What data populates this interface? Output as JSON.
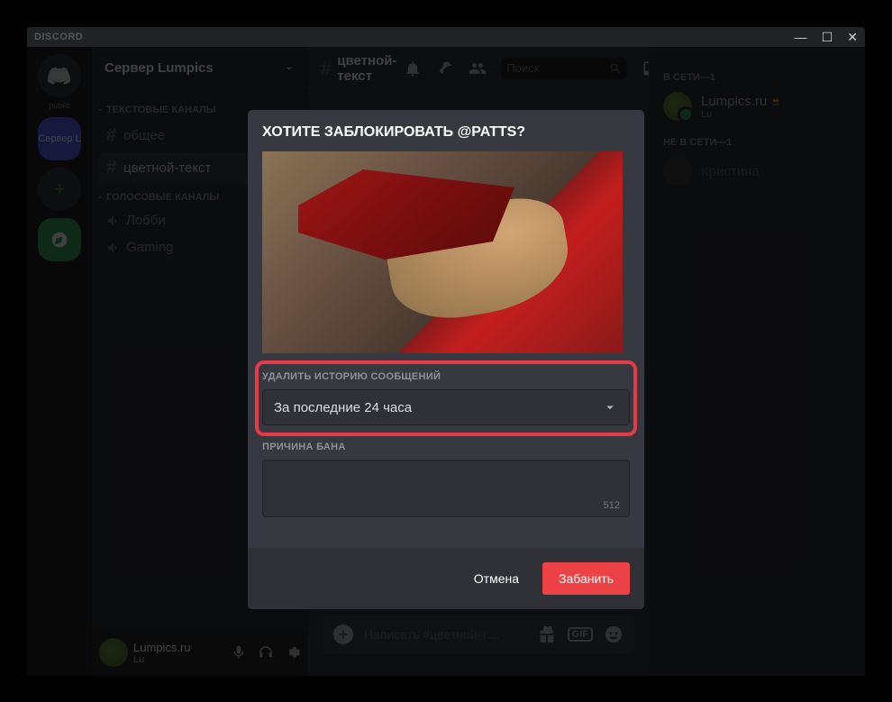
{
  "titlebar": {
    "logo": "DISCORD"
  },
  "server_col": {
    "public_label": "public",
    "active_label": "Сервер L"
  },
  "server": {
    "name": "Сервер Lumpics"
  },
  "categories": {
    "text": {
      "label": "ТЕКСТОВЫЕ КАНАЛЫ",
      "channels": [
        "общее",
        "цветной-текст"
      ]
    },
    "voice": {
      "label": "ГОЛОСОВЫЕ КАНАЛЫ",
      "channels": [
        "Лобби",
        "Gaming"
      ]
    }
  },
  "current_channel": "цветной-текст",
  "user_panel": {
    "name": "Lumpics.ru",
    "tag": "Lu"
  },
  "search": {
    "placeholder": "Поиск"
  },
  "compose": {
    "placeholder": "Написать #цветной-т…"
  },
  "members": {
    "online": {
      "label": "В СЕТИ—1",
      "users": [
        {
          "name": "Lumpics.ru",
          "sub": "Lu",
          "owner": true
        }
      ]
    },
    "offline": {
      "label": "НЕ В СЕТИ—1",
      "users": [
        {
          "name": "Кристина"
        }
      ]
    }
  },
  "modal": {
    "title": "ХОТИТЕ ЗАБЛОКИРОВАТЬ @PATTS?",
    "delete_history": {
      "label": "УДАЛИТЬ ИСТОРИЮ СООБЩЕНИЙ",
      "value": "За последние 24 часа"
    },
    "reason": {
      "label": "ПРИЧИНА БАНА",
      "counter": "512"
    },
    "cancel": "Отмена",
    "confirm": "Забанить"
  }
}
